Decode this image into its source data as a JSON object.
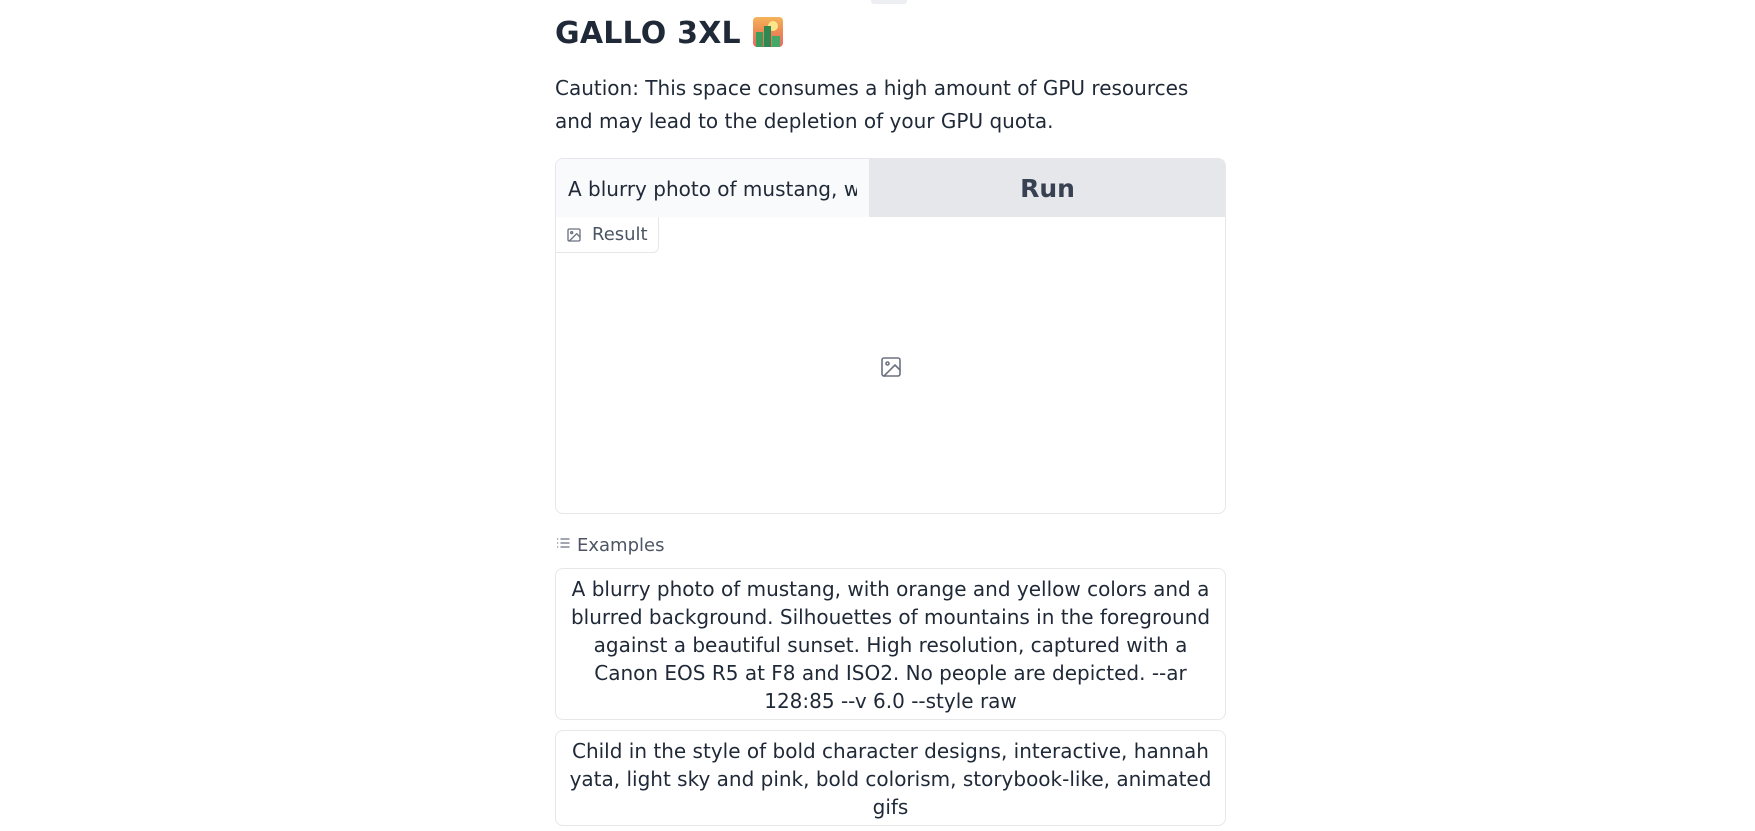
{
  "header": {
    "title": "GALLO 3XL",
    "title_icon": "sunrise-over-buildings-emoji",
    "description": "Caution: This space consumes a high amount of GPU resources and may lead to the depletion of your GPU quota."
  },
  "form": {
    "prompt_value": "A blurry photo of mustang, w",
    "run_label": "Run"
  },
  "result": {
    "label": "Result",
    "label_icon": "image-icon",
    "placeholder_icon": "image-icon"
  },
  "examples": {
    "label": "Examples",
    "label_icon": "list-icon",
    "items": [
      "A blurry photo of mustang, with orange and yellow colors and a blurred background. Silhouettes of mountains in the foreground against a beautiful sunset. High resolution, captured with a Canon EOS R5 at F8 and ISO2. No people are depicted. --ar 128:85 --v 6.0 --style raw",
      "Child in the style of bold character designs, interactive, hannah yata, light sky and pink, bold colorism, storybook-like, animated gifs"
    ]
  },
  "colors": {
    "button_bg": "#e5e7eb",
    "border": "#e5e7eb",
    "text": "#1f2937",
    "muted_text": "#4b5563"
  }
}
